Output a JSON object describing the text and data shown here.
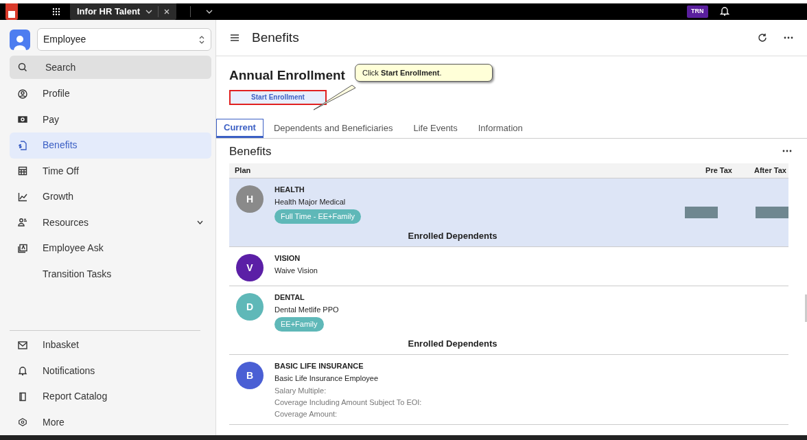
{
  "top_bar": {
    "tab_title": "Infor HR Talent",
    "environment_badge": "TRN"
  },
  "sidebar": {
    "role_select": {
      "value": "Employee"
    },
    "search": {
      "label": "Search"
    },
    "items": [
      {
        "label": "Profile",
        "selected": false
      },
      {
        "label": "Pay",
        "selected": false
      },
      {
        "label": "Benefits",
        "selected": true
      },
      {
        "label": "Time Off",
        "selected": false
      },
      {
        "label": "Growth",
        "selected": false
      },
      {
        "label": "Resources",
        "selected": false,
        "expanded": false
      },
      {
        "label": "Employee Ask",
        "selected": false
      },
      {
        "label": "Transition Tasks",
        "selected": false
      }
    ],
    "bottom_items": [
      {
        "label": "Inbasket"
      },
      {
        "label": "Notifications"
      },
      {
        "label": "Report Catalog"
      },
      {
        "label": "More"
      }
    ]
  },
  "header": {
    "title": "Benefits"
  },
  "enrollment": {
    "title": "Annual Enrollment",
    "button": "Start Enrollment",
    "callout": "Click **Start Enrollment**."
  },
  "tabs": [
    {
      "label": "Current",
      "selected": true
    },
    {
      "label": "Dependents and Beneficiaries",
      "selected": false
    },
    {
      "label": "Life Events",
      "selected": false
    },
    {
      "label": "Information",
      "selected": false
    }
  ],
  "benefits": {
    "title": "Benefits",
    "columns": [
      "Plan",
      "Pre Tax",
      "After Tax"
    ],
    "plans": [
      {
        "letter": "H",
        "color": "#8a8a8a",
        "name": "HEALTH",
        "plan": "Health Major Medical",
        "tag": "Full Time - EE+Family",
        "enrolled_dependents": "Enrolled Dependents",
        "amounts_hidden": true,
        "selected": true
      },
      {
        "letter": "V",
        "color": "#5b1fa6",
        "name": "VISION",
        "plan": "Waive Vision",
        "amounts_hidden": false,
        "selected": false
      },
      {
        "letter": "D",
        "color": "#5fb8b8",
        "name": "DENTAL",
        "plan": "Dental Metlife PPO",
        "tag": "EE+Family",
        "enrolled_dependents": "Enrolled Dependents",
        "amounts_hidden": false,
        "selected": false
      },
      {
        "letter": "B",
        "color": "#4a5fd4",
        "name": "BASIC LIFE INSURANCE",
        "plan": "Basic Life Insurance Employee",
        "details": [
          "Salary Multiple:",
          "Coverage Including Amount Subject To EOI:",
          "Coverage Amount:"
        ],
        "amounts_hidden": false,
        "selected": false
      }
    ]
  }
}
